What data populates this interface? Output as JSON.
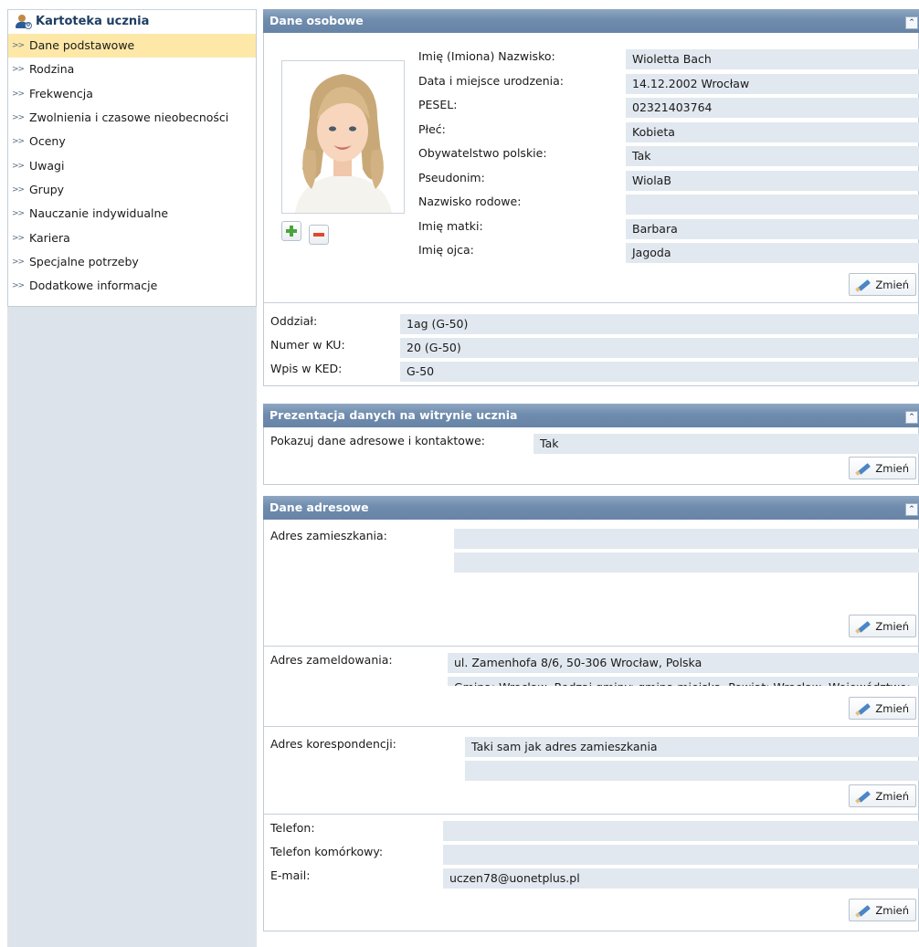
{
  "sidebar": {
    "title": "Kartoteka ucznia",
    "items": [
      {
        "label": "Dane podstawowe",
        "active": true
      },
      {
        "label": "Rodzina"
      },
      {
        "label": "Frekwencja"
      },
      {
        "label": "Zwolnienia i czasowe nieobecności"
      },
      {
        "label": "Oceny"
      },
      {
        "label": "Uwagi"
      },
      {
        "label": "Grupy"
      },
      {
        "label": "Nauczanie indywidualne"
      },
      {
        "label": "Kariera"
      },
      {
        "label": "Specjalne potrzeby"
      },
      {
        "label": "Dodatkowe informacje"
      }
    ]
  },
  "personal": {
    "header": "Dane osobowe",
    "fields": [
      {
        "label": "Imię (Imiona) Nazwisko:",
        "value": "Wioletta Bach"
      },
      {
        "label": "Data i miejsce urodzenia:",
        "value": "14.12.2002 Wrocław"
      },
      {
        "label": "PESEL:",
        "value": "02321403764"
      },
      {
        "label": "Płeć:",
        "value": "Kobieta"
      },
      {
        "label": "Obywatelstwo polskie:",
        "value": "Tak"
      },
      {
        "label": "Pseudonim:",
        "value": "WiolaB"
      },
      {
        "label": "Nazwisko rodowe:",
        "value": ""
      },
      {
        "label": "Imię matki:",
        "value": "Barbara"
      },
      {
        "label": "Imię ojca:",
        "value": "Jagoda"
      }
    ],
    "change_label": "Zmień",
    "class_fields": [
      {
        "label": "Oddział:",
        "value": "1ag (G-50)"
      },
      {
        "label": "Numer w KU:",
        "value": "20 (G-50)"
      },
      {
        "label": "Wpis w KED:",
        "value": "G-50"
      }
    ]
  },
  "presentation": {
    "header": "Prezentacja danych na witrynie ucznia",
    "label": "Pokazuj dane adresowe i kontaktowe:",
    "value": "Tak",
    "change_label": "Zmień"
  },
  "address": {
    "header": "Dane adresowe",
    "residence": {
      "label": "Adres zamieszkania:",
      "line1": "",
      "line2": ""
    },
    "registered": {
      "label": "Adres zameldowania:",
      "line1": "ul. Zamenhofa 8/6, 50-306 Wrocław, Polska",
      "line2": "Gmina: Wrocław, Rodzaj gminy: gmina miejska, Powiat: Wrocław, Województwo: DOLNOŚLĄSKIE"
    },
    "correspondence": {
      "label": "Adres korespondencji:",
      "line1": "Taki sam jak adres zamieszkania",
      "line2": ""
    },
    "contact": [
      {
        "label": "Telefon:",
        "value": ""
      },
      {
        "label": "Telefon komórkowy:",
        "value": ""
      },
      {
        "label": "E-mail:",
        "value": "uczen78@uonetplus.pl"
      }
    ],
    "change_label": "Zmień"
  },
  "icons": {
    "collapse": "double-chevron-up-icon",
    "add": "plus-icon",
    "remove": "minus-icon",
    "edit": "pencil-icon"
  }
}
